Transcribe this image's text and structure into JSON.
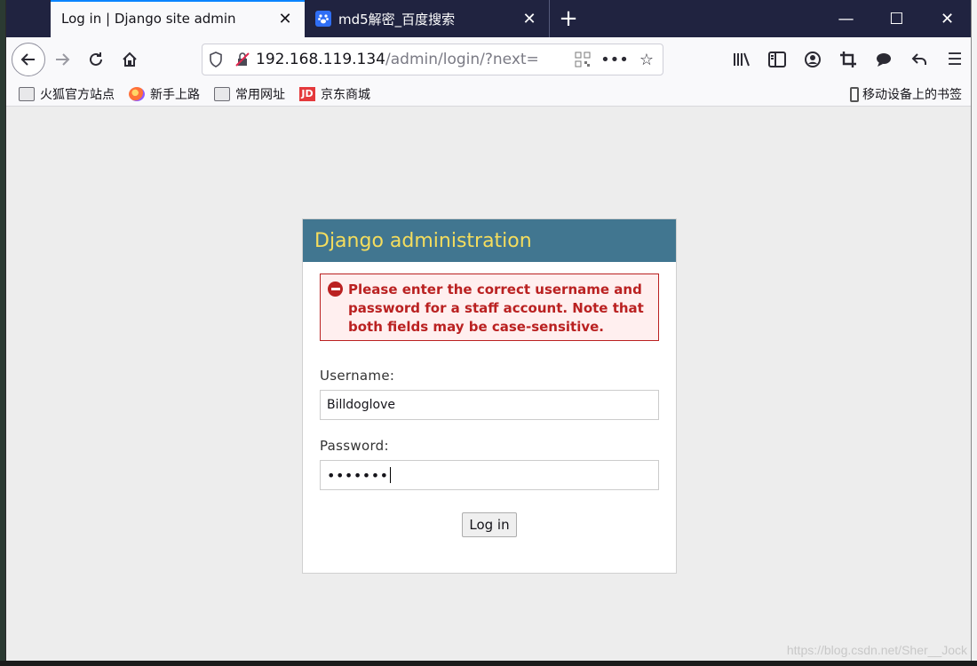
{
  "browser": {
    "tabs": [
      {
        "title": "Log in | Django site admin",
        "active": true
      },
      {
        "title": "md5解密_百度搜索",
        "active": false
      }
    ],
    "url_host": "192.168.119.134",
    "url_path": "/admin/login/?next=",
    "bookmarks": [
      {
        "label": "火狐官方站点",
        "icon": "folder-icon"
      },
      {
        "label": "新手上路",
        "icon": "firefox-icon"
      },
      {
        "label": "常用网址",
        "icon": "folder-icon"
      },
      {
        "label": "京东商城",
        "icon": "jd-icon",
        "icon_text": "JD"
      }
    ],
    "mobile_bookmarks": "移动设备上的书签"
  },
  "login": {
    "header": "Django administration",
    "error": "Please enter the correct username and password for a staff account. Note that both fields may be case-sensitive.",
    "username_label": "Username:",
    "username_value": "Billdoglove",
    "password_label": "Password:",
    "password_value": "•••••••",
    "submit_label": "Log in"
  },
  "watermark": "https://blog.csdn.net/Sher__Jock",
  "colors": {
    "header_bg": "#417690",
    "header_text": "#f5dd5d",
    "error": "#ba2121",
    "tabstrip": "#202340"
  }
}
